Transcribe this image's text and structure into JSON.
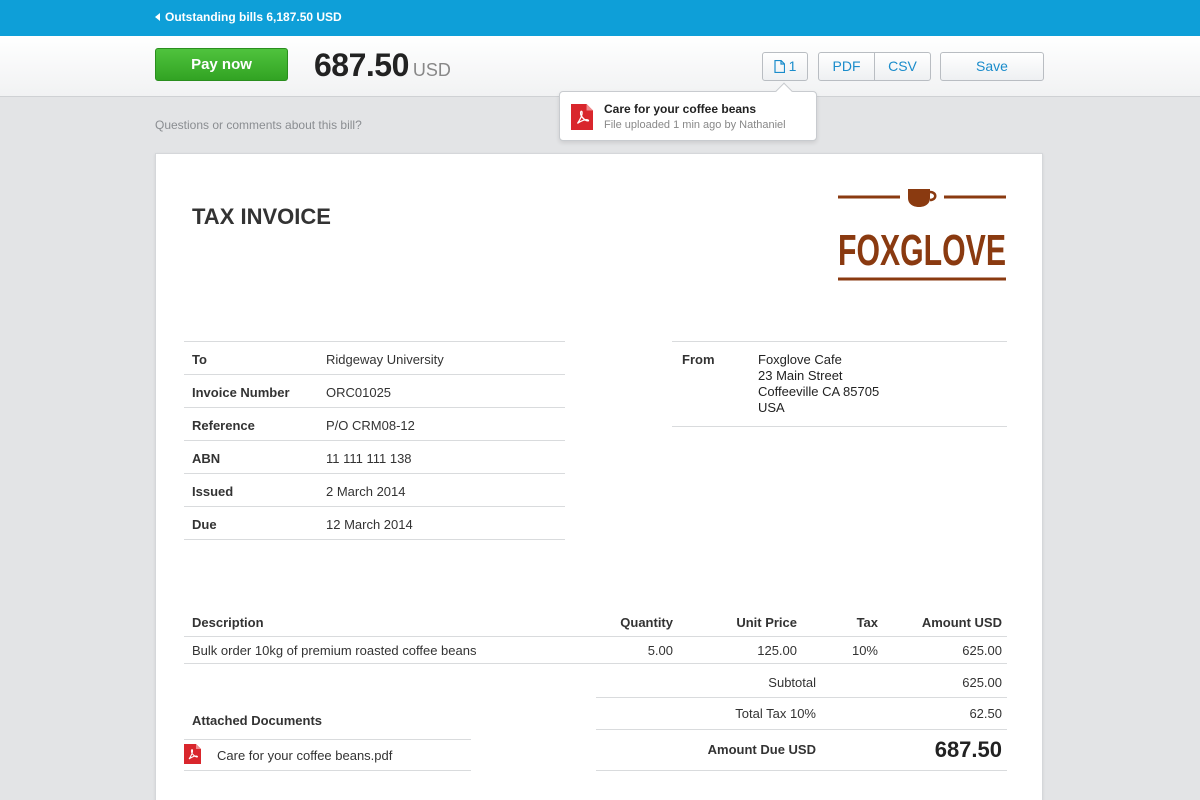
{
  "topbar": {
    "back_label": "Outstanding bills 6,187.50 USD"
  },
  "header": {
    "pay_label": "Pay now",
    "amount": "687.50",
    "currency": "USD",
    "files_count": "1",
    "pdf_label": "PDF",
    "csv_label": "CSV",
    "save_label": "Save"
  },
  "tooltip": {
    "title": "Care for your coffee beans",
    "subtitle": "File uploaded 1 min ago by Nathaniel"
  },
  "questions_link": "Questions or comments about this bill?",
  "invoice": {
    "title": "TAX INVOICE",
    "logo_text": "FOXGLOVE",
    "details": [
      {
        "label": "To",
        "value": "Ridgeway University"
      },
      {
        "label": "Invoice Number",
        "value": "ORC01025"
      },
      {
        "label": "Reference",
        "value": "P/O CRM08-12"
      },
      {
        "label": "ABN",
        "value": "11 111 111 138"
      },
      {
        "label": "Issued",
        "value": "2 March 2014"
      },
      {
        "label": "Due",
        "value": "12 March 2014"
      }
    ],
    "from": {
      "label": "From",
      "line1": "Foxglove Cafe",
      "line2": "23 Main Street",
      "line3": "Coffeeville CA 85705",
      "line4": "USA"
    },
    "columns": {
      "description": "Description",
      "quantity": "Quantity",
      "unit_price": "Unit Price",
      "tax": "Tax",
      "amount": "Amount USD"
    },
    "line_items": [
      {
        "description": "Bulk order 10kg of premium roasted coffee beans",
        "quantity": "5.00",
        "unit_price": "125.00",
        "tax": "10%",
        "amount": "625.00"
      }
    ],
    "attachments_title": "Attached Documents",
    "attachments": [
      {
        "name": "Care for your coffee beans.pdf"
      }
    ],
    "totals": {
      "subtotal_label": "Subtotal",
      "subtotal_value": "625.00",
      "tax_label": "Total Tax 10%",
      "tax_value": "62.50",
      "due_label": "Amount Due USD",
      "due_value": "687.50"
    }
  },
  "colors": {
    "topbar": "#0e9fd8",
    "pay_button": "#3aab2a",
    "link_blue": "#1a8ccb",
    "logo_brown": "#8a3a10",
    "pdf_red": "#d9262c"
  }
}
